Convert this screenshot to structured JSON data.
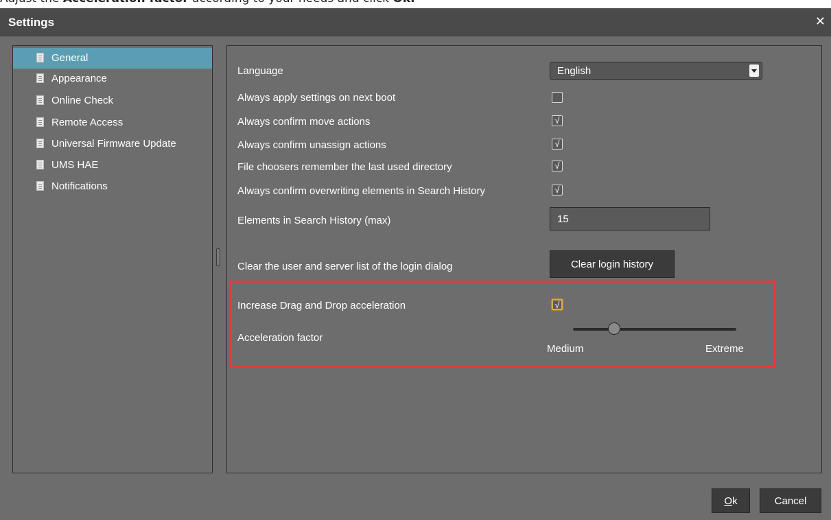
{
  "instruction": {
    "prefix": "Adjust the ",
    "bold1": "Acceleration factor",
    "middle": " according to your needs and click ",
    "bold2": "Ok."
  },
  "dialog": {
    "title": "Settings",
    "close_glyph": "✕"
  },
  "sidebar": {
    "items": [
      {
        "label": "General",
        "selected": true,
        "icon": "document-icon"
      },
      {
        "label": "Appearance",
        "selected": false,
        "icon": "document-icon"
      },
      {
        "label": "Online Check",
        "selected": false,
        "icon": "document-icon"
      },
      {
        "label": "Remote Access",
        "selected": false,
        "icon": "document-icon"
      },
      {
        "label": "Universal Firmware Update",
        "selected": false,
        "icon": "document-icon"
      },
      {
        "label": "UMS HAE",
        "selected": false,
        "icon": "document-icon"
      },
      {
        "label": "Notifications",
        "selected": false,
        "icon": "document-icon"
      }
    ]
  },
  "general": {
    "language_label": "Language",
    "language_value": "English",
    "checks": [
      {
        "label": "Always apply settings on next boot",
        "checked": false
      },
      {
        "label": "Always confirm move actions",
        "checked": true
      },
      {
        "label": "Always confirm unassign actions",
        "checked": true
      },
      {
        "label": "File choosers remember the last used directory",
        "checked": true
      },
      {
        "label": "Always confirm overwriting elements in Search History",
        "checked": true
      }
    ],
    "search_history_label": "Elements in Search History (max)",
    "search_history_value": "15",
    "clear_login_label": "Clear the user and server list of the login dialog",
    "clear_login_button": "Clear login history",
    "dnd_label": "Increase Drag and Drop acceleration",
    "dnd_checked": true,
    "accel_label": "Acceleration factor",
    "accel_min_label": "Medium",
    "accel_max_label": "Extreme",
    "accel_value_fraction": 0.25
  },
  "footer": {
    "ok_label": "Ok",
    "ok_mnemonic": "O",
    "cancel_label": "Cancel"
  },
  "colors": {
    "dialog_bg": "#6d6d6d",
    "titlebar_bg": "#4a4a4a",
    "selection": "#5b9eb3",
    "highlight": "#e53b3b",
    "focus": "#e0a94a"
  },
  "check_glyph": "√"
}
